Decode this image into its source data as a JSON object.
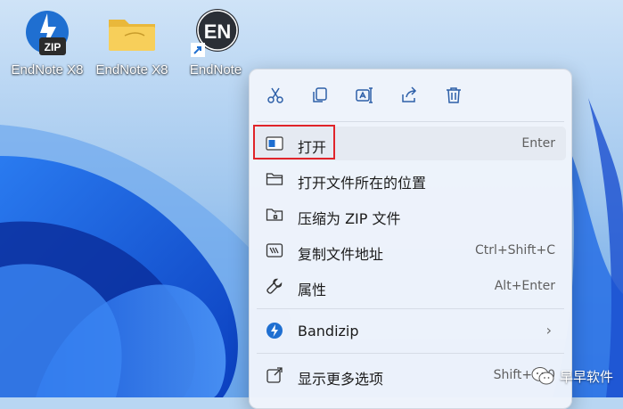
{
  "desktop": {
    "icons": [
      {
        "label": "EndNote X8",
        "icon": "bandizip-zip-icon"
      },
      {
        "label": "EndNote X8",
        "icon": "folder-icon"
      },
      {
        "label": "EndNote",
        "icon": "endnote-shortcut-icon"
      }
    ]
  },
  "context_menu": {
    "toolbar": [
      {
        "name": "cut",
        "icon": "scissors-icon"
      },
      {
        "name": "copy",
        "icon": "copy-icon"
      },
      {
        "name": "rename",
        "icon": "rename-icon"
      },
      {
        "name": "share",
        "icon": "share-icon"
      },
      {
        "name": "delete",
        "icon": "trash-icon"
      }
    ],
    "items": [
      {
        "label": "打开",
        "shortcut": "Enter",
        "icon": "open-app-icon"
      },
      {
        "label": "打开文件所在的位置",
        "shortcut": "",
        "icon": "folder-outline-icon"
      },
      {
        "label": "压缩为 ZIP 文件",
        "shortcut": "",
        "icon": "zip-folder-icon"
      },
      {
        "label": "复制文件地址",
        "shortcut": "Ctrl+Shift+C",
        "icon": "copy-path-icon"
      },
      {
        "label": "属性",
        "shortcut": "Alt+Enter",
        "icon": "wrench-icon"
      },
      {
        "label": "Bandizip",
        "shortcut": "",
        "icon": "bandizip-icon",
        "submenu_arrow": "›"
      },
      {
        "label": "显示更多选项",
        "shortcut": "Shift+F10",
        "icon": "show-more-icon"
      }
    ]
  },
  "watermark": {
    "text": "早早软件",
    "icon": "wechat-icon"
  },
  "colors": {
    "highlight": "#e0242a",
    "accent": "#1f6fd1",
    "menu_bg": "#f0f4fb"
  }
}
